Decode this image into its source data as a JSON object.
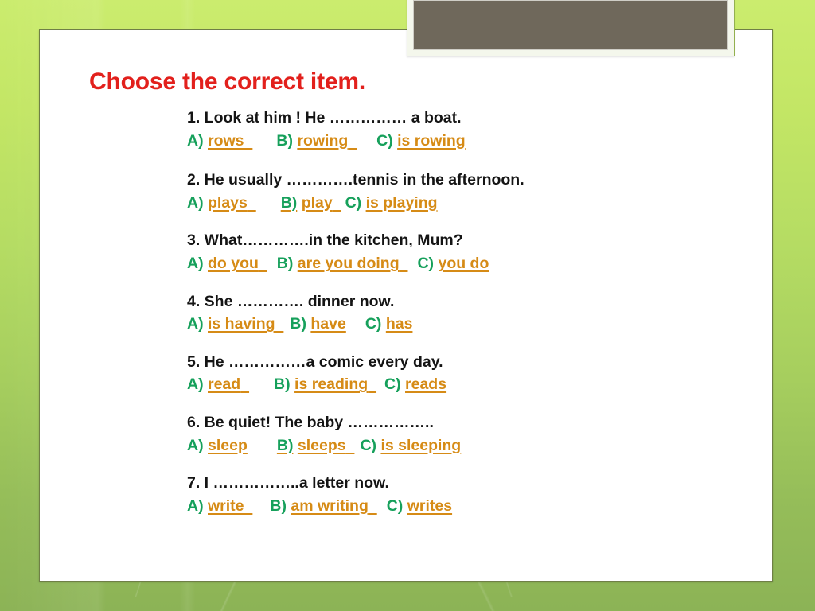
{
  "slide": {
    "title": "Choose the correct item.",
    "title_color": "#e2201c",
    "label_color": "#16a05b",
    "answer_color": "#d68b16",
    "background_top_color": "#cbec6e",
    "background_bottom_color": "#8cb356",
    "picture_placeholder_color": "#6f685b"
  },
  "questions": [
    {
      "number": "1.",
      "prompt": "1.   Look at him ! He …………… a boat.",
      "options": [
        {
          "label": "A)",
          "text": "rows",
          "trailing_space": true,
          "label_underlined": false
        },
        {
          "label": "B)",
          "text": "rowing",
          "trailing_space": true,
          "label_underlined": false
        },
        {
          "label": "C)",
          "text": "is rowing",
          "trailing_space": false,
          "label_underlined": false
        }
      ]
    },
    {
      "number": "2.",
      "prompt": "2. He usually ………….tennis in the afternoon.",
      "options": [
        {
          "label": "A)",
          "text": "plays",
          "trailing_space": true,
          "label_underlined": false
        },
        {
          "label": "B)",
          "text": " play",
          "trailing_space": true,
          "label_underlined": true
        },
        {
          "label": "C)",
          "text": "is playing",
          "trailing_space": false,
          "label_underlined": false
        }
      ]
    },
    {
      "number": "3.",
      "prompt": "3. What………….in the kitchen, Mum?",
      "options": [
        {
          "label": "A)",
          "text": "do you",
          "trailing_space": true,
          "label_underlined": false
        },
        {
          "label": "B)",
          "text": "are you doing",
          "trailing_space": true,
          "label_underlined": false
        },
        {
          "label": "C)",
          "text": "you do",
          "trailing_space": false,
          "label_underlined": false
        }
      ]
    },
    {
      "number": "4.",
      "prompt": "4. She …………. dinner now.",
      "options": [
        {
          "label": "A)",
          "text": "is having",
          "trailing_space": true,
          "label_underlined": false
        },
        {
          "label": "B)",
          "text": "have",
          "trailing_space": false,
          "label_underlined": false
        },
        {
          "label": "C)",
          "text": "has",
          "trailing_space": false,
          "label_underlined": false
        }
      ]
    },
    {
      "number": "5.",
      "prompt": "5. He ……………a comic every day.",
      "options": [
        {
          "label": "A)",
          "text": "read",
          "trailing_space": true,
          "label_underlined": false
        },
        {
          "label": "B)",
          "text": "is reading",
          "trailing_space": true,
          "label_underlined": false
        },
        {
          "label": "C)",
          "text": "reads",
          "trailing_space": false,
          "label_underlined": false
        }
      ]
    },
    {
      "number": "6.",
      "prompt": "6. Be quiet! The baby ……………..",
      "options": [
        {
          "label": "A)",
          "text": "sleep",
          "trailing_space": false,
          "label_underlined": false
        },
        {
          "label": "B)",
          "text": " sleeps",
          "trailing_space": true,
          "label_underlined": true
        },
        {
          "label": "C)",
          "text": "is sleeping",
          "trailing_space": false,
          "label_underlined": false
        }
      ]
    },
    {
      "number": "7.",
      "prompt": "7. I ……………..a letter now.",
      "options": [
        {
          "label": "A)",
          "text": "write",
          "trailing_space": true,
          "label_underlined": false
        },
        {
          "label": "B)",
          "text": "am writing",
          "trailing_space": true,
          "label_underlined": false
        },
        {
          "label": "C)",
          "text": "writes",
          "trailing_space": false,
          "label_underlined": false
        }
      ]
    }
  ]
}
